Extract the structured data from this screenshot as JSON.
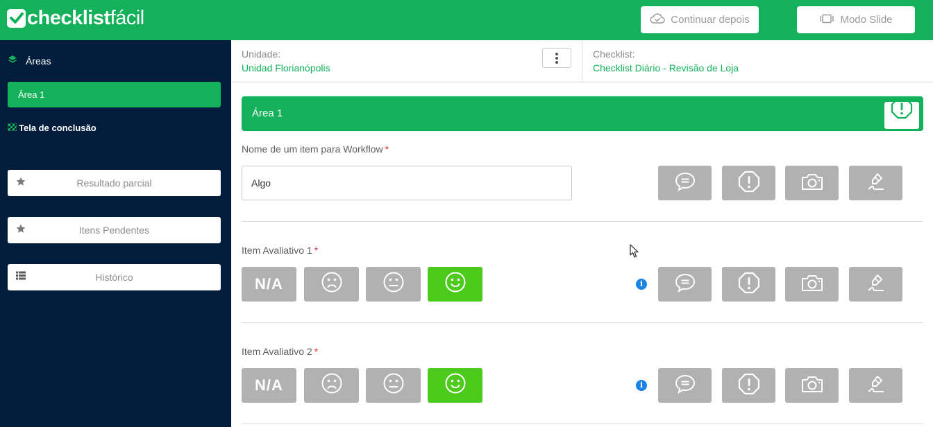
{
  "app": {
    "logo_bold": "checklist",
    "logo_light": "fácil"
  },
  "topbar": {
    "continue_label": "Continuar depois",
    "slide_label": "Modo Slide"
  },
  "sidebar": {
    "areas_heading": "Áreas",
    "active_area": "Área 1",
    "conclusion_label": "Tela de conclusão",
    "buttons": [
      {
        "label": "Resultado parcial",
        "icon": "star-icon"
      },
      {
        "label": "Itens Pendentes",
        "icon": "star-icon"
      },
      {
        "label": "Histórico",
        "icon": "list-icon"
      }
    ]
  },
  "header": {
    "unit_label": "Unidade:",
    "unit_value": "Unidad Florianópolis",
    "checklist_label": "Checklist:",
    "checklist_value": "Checklist Diário - Revisão de Loja"
  },
  "area": {
    "title": "Área 1"
  },
  "items": [
    {
      "label": "Nome de um item para Workflow",
      "required_mark": "*",
      "type": "text",
      "value": "Algo"
    },
    {
      "label": "Item Avaliativo 1",
      "required_mark": "*",
      "type": "rating",
      "na_label": "N/A",
      "selected": "happy"
    },
    {
      "label": "Item Avaliativo 2",
      "required_mark": "*",
      "type": "rating",
      "na_label": "N/A",
      "selected": "happy"
    }
  ],
  "colors": {
    "brand": "#13b25a",
    "sidebar": "#021d3b",
    "selected_rating": "#4ccb1d",
    "button_gray": "#b1b1b1",
    "required": "#e8343e",
    "info": "#1a84e6"
  }
}
